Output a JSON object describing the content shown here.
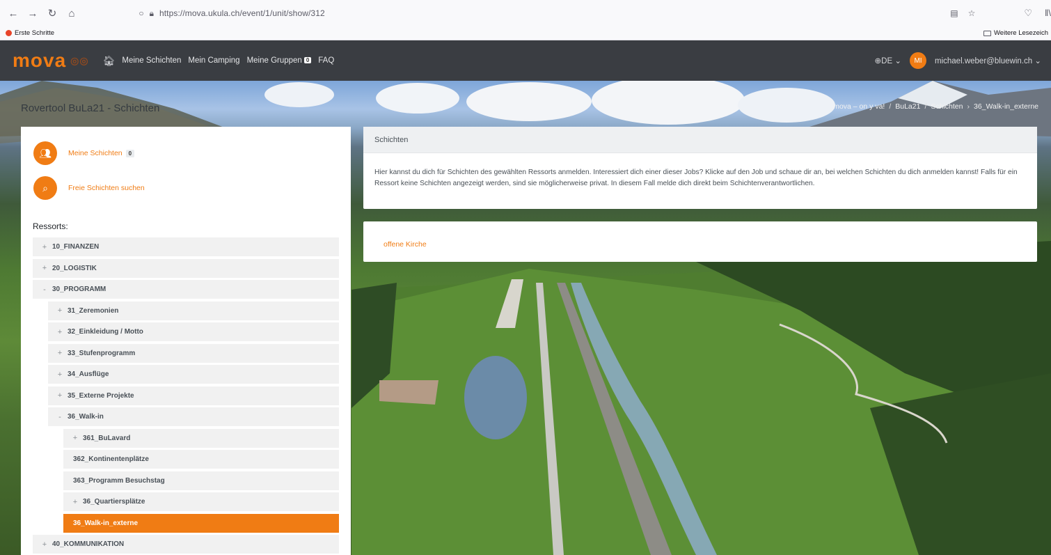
{
  "browser": {
    "url": "https://mova.ukula.ch/event/1/unit/show/312",
    "bookmark_left": "Erste Schritte",
    "bookmark_right": "Weitere Lesezeich"
  },
  "nav": {
    "logo": "mova",
    "links": [
      "Meine Schichten",
      "Mein Camping",
      "Meine Gruppen",
      "FAQ"
    ],
    "groups_badge": "0",
    "language": "DE",
    "avatar_initials": "MI",
    "user_email": "michael.weber@bluewin.ch"
  },
  "page": {
    "heading": "Rovertool BuLa21 - Schichten",
    "breadcrumb": [
      "mova – on y va!",
      "BuLa21",
      "Schichten",
      "36_Walk-in_externe"
    ]
  },
  "sidebar": {
    "my_shifts_label": "Meine Schichten",
    "my_shifts_badge": "0",
    "free_shifts_label": "Freie Schichten suchen",
    "ressorts_title": "Ressorts:",
    "tree": [
      {
        "label": "10_FINANZEN",
        "sign": "+",
        "level": 0
      },
      {
        "label": "20_LOGISTIK",
        "sign": "+",
        "level": 0
      },
      {
        "label": "30_PROGRAMM",
        "sign": "-",
        "level": 0
      },
      {
        "label": "31_Zeremonien",
        "sign": "+",
        "level": 1
      },
      {
        "label": "32_Einkleidung / Motto",
        "sign": "+",
        "level": 1
      },
      {
        "label": "33_Stufenprogramm",
        "sign": "+",
        "level": 1
      },
      {
        "label": "34_Ausflüge",
        "sign": "+",
        "level": 1
      },
      {
        "label": "35_Externe Projekte",
        "sign": "+",
        "level": 1
      },
      {
        "label": "36_Walk-in",
        "sign": "-",
        "level": 1
      },
      {
        "label": "361_BuLavard",
        "sign": "+",
        "level": 2
      },
      {
        "label": "362_Kontinentenplätze",
        "sign": "",
        "level": 2
      },
      {
        "label": "363_Programm Besuchstag",
        "sign": "",
        "level": 2
      },
      {
        "label": "36_Quartiersplätze",
        "sign": "+",
        "level": 2
      },
      {
        "label": "36_Walk-in_externe",
        "sign": "",
        "level": 2,
        "active": true
      },
      {
        "label": "40_KOMMUNIKATION",
        "sign": "+",
        "level": 0
      }
    ]
  },
  "main": {
    "info_card": {
      "header": "Schichten",
      "body": "Hier kannst du dich für Schichten des gewählten Ressorts anmelden. Interessiert dich einer dieser Jobs? Klicke auf den Job und schaue dir an, bei welchen Schichten du dich anmelden kannst! Falls für ein Ressort keine Schichten angezeigt werden, sind sie möglicherweise privat. In diesem Fall melde dich direkt beim Schichtenverantwortlichen."
    },
    "job_card": {
      "job": "offene Kirche"
    }
  },
  "colors": {
    "accent": "#f07c14",
    "navbar": "#3a3d42"
  }
}
